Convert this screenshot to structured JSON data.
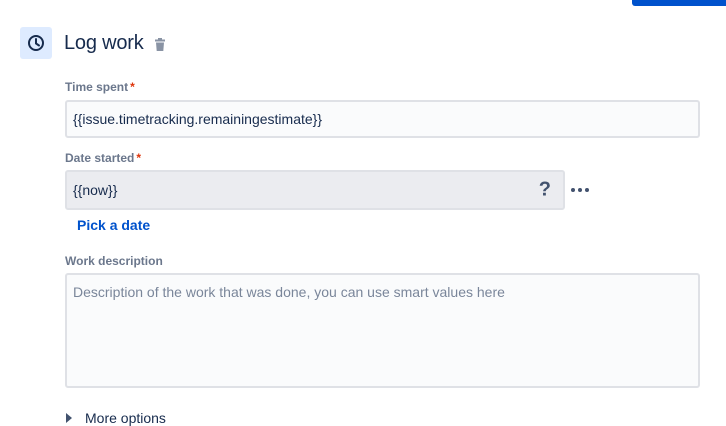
{
  "header": {
    "title": "Log work",
    "icon": "clock-icon",
    "delete_icon": "trash-icon"
  },
  "fields": {
    "time_spent": {
      "label": "Time spent",
      "required_mark": "*",
      "value": "{{issue.timetracking.remainingestimate}}"
    },
    "date_started": {
      "label": "Date started",
      "required_mark": "*",
      "value": "{{now}}",
      "help_glyph": "?",
      "pick_date_link": "Pick a date"
    },
    "work_description": {
      "label": "Work description",
      "placeholder": "Description of the work that was done, you can use smart values here"
    }
  },
  "more_options": {
    "label": "More options"
  },
  "colors": {
    "accent": "#0052cc",
    "icon_bg": "#deebff",
    "required": "#de350b"
  }
}
